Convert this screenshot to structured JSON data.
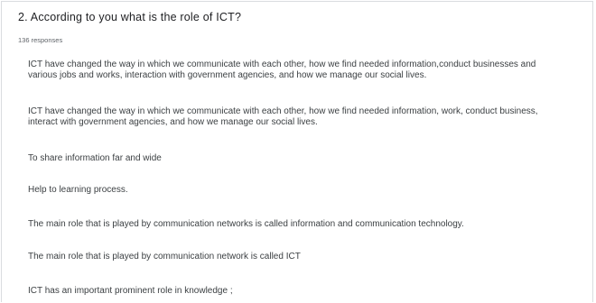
{
  "question": {
    "title": "2. According to you what is the role of ICT?",
    "response_count": "136 responses"
  },
  "responses": [
    "ICT have changed the way in which we communicate with each other, how we find needed information,conduct businesses and various jobs and works, interaction with government agencies, and how we manage our social lives.",
    "ICT have changed the way in which we communicate with each other, how we find needed information, work, conduct business, interact with government agencies, and how we manage our social lives.",
    "To share information far and wide",
    "Help to learning process.",
    "The main role that is played by communication networks is called information and communication technology.",
    "The main role that is played by communication network is called ICT",
    "ICT has an important prominent role in knowledge ;"
  ]
}
